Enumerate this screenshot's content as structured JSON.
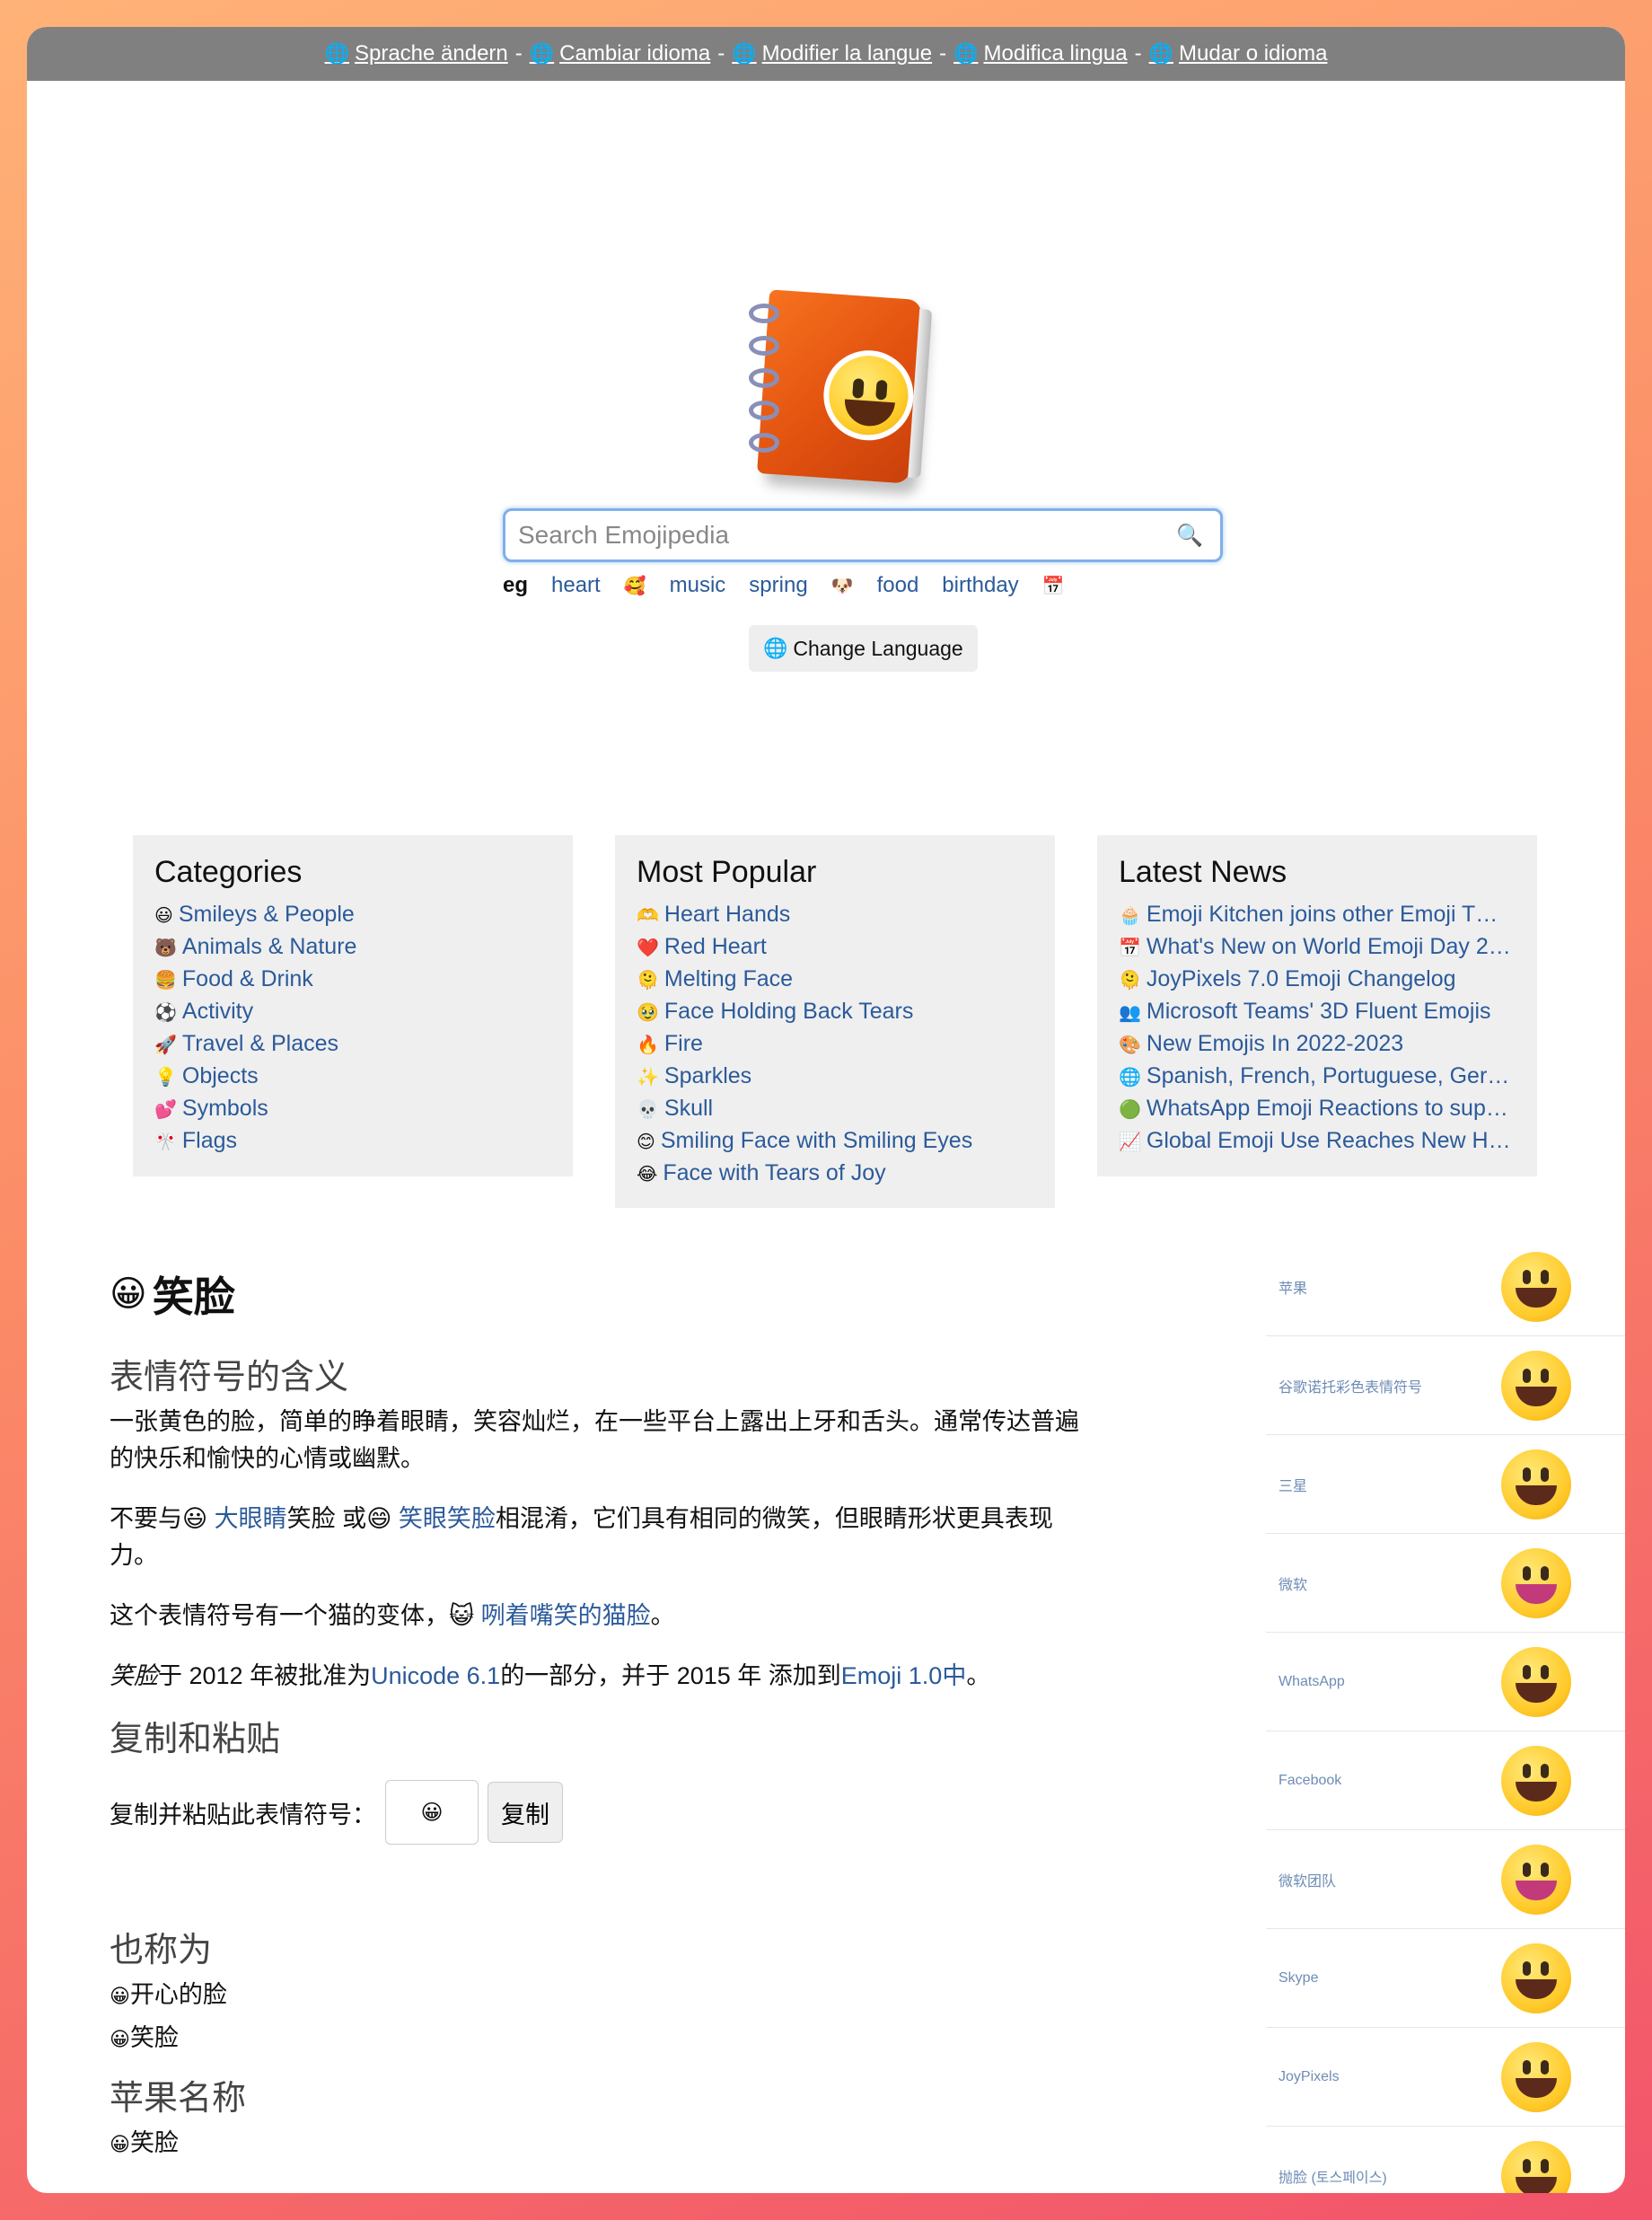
{
  "language_bar": {
    "items": [
      "Sprache ändern",
      "Cambiar idioma",
      "Modifier la langue",
      "Modifica lingua",
      "Mudar o idioma"
    ],
    "separator": "-"
  },
  "search": {
    "placeholder": "Search Emojipedia",
    "button_icon": "🔍",
    "suggestions_label": "eg",
    "suggestions": [
      {
        "label": "heart",
        "emoji": "🥰"
      },
      {
        "label": "music",
        "emoji": ""
      },
      {
        "label": "spring",
        "emoji": "🐶"
      },
      {
        "label": "food",
        "emoji": ""
      },
      {
        "label": "birthday",
        "emoji": "📅"
      }
    ]
  },
  "change_language": "Change Language",
  "categories": {
    "title": "Categories",
    "items": [
      {
        "icon": "😃",
        "label": "Smileys & People"
      },
      {
        "icon": "🐻",
        "label": "Animals & Nature"
      },
      {
        "icon": "🍔",
        "label": "Food & Drink"
      },
      {
        "icon": "⚽",
        "label": "Activity"
      },
      {
        "icon": "🚀",
        "label": "Travel & Places"
      },
      {
        "icon": "💡",
        "label": "Objects"
      },
      {
        "icon": "💕",
        "label": "Symbols"
      },
      {
        "icon": "🎌",
        "label": "Flags"
      }
    ]
  },
  "most_popular": {
    "title": "Most Popular",
    "items": [
      {
        "icon": "🫶",
        "label": "Heart Hands"
      },
      {
        "icon": "❤️",
        "label": "Red Heart"
      },
      {
        "icon": "🫠",
        "label": "Melting Face"
      },
      {
        "icon": "🥹",
        "label": "Face Holding Back Tears"
      },
      {
        "icon": "🔥",
        "label": "Fire"
      },
      {
        "icon": "✨",
        "label": "Sparkles"
      },
      {
        "icon": "💀",
        "label": "Skull"
      },
      {
        "icon": "😊",
        "label": "Smiling Face with Smiling Eyes"
      },
      {
        "icon": "😂",
        "label": "Face with Tears of Joy"
      }
    ]
  },
  "latest_news": {
    "title": "Latest News",
    "items": [
      {
        "icon": "🧁",
        "label": "Emoji Kitchen joins other Emoji T…"
      },
      {
        "icon": "📅",
        "label": "What's New on World Emoji Day 2…"
      },
      {
        "icon": "🫠",
        "label": "JoyPixels 7.0 Emoji Changelog"
      },
      {
        "icon": "👥",
        "label": "Microsoft Teams' 3D Fluent Emojis"
      },
      {
        "icon": "🎨",
        "label": "New Emojis In 2022-2023"
      },
      {
        "icon": "🌐",
        "label": "Spanish, French, Portuguese, Ger…"
      },
      {
        "icon": "🟢",
        "label": "WhatsApp Emoji Reactions to sup…"
      },
      {
        "icon": "📈",
        "label": "Global Emoji Use Reaches New H…"
      }
    ]
  },
  "emoji": {
    "glyph": "😀",
    "name": "笑脸",
    "meaning_heading": "表情符号的含义",
    "meaning_text": "一张黄色的脸，简单的睁着眼睛，笑容灿烂，在一些平台上露出上牙和舌头。通常传达普遍的快乐和愉快的心情或幽默。",
    "confusion": {
      "prefix": "不要与",
      "e1": "😃",
      "link1": "大眼睛",
      "mid1": "笑脸 或",
      "e2": "😄",
      "link2": "笑眼笑脸",
      "suffix": "相混淆，它们具有相同的微笑，但眼睛形状更具表现力。"
    },
    "variant": {
      "prefix": "这个表情符号有一个猫的变体，",
      "e": "😺",
      "link": "咧着嘴笑的猫脸",
      "suffix": "。"
    },
    "approval": {
      "name_italic": "笑脸",
      "p1": "于 2012 年被批准为",
      "link1": "Unicode 6.1",
      "p2": "的一部分，并于 2015 年 添加到",
      "link2": "Emoji 1.0中",
      "p3": "。"
    },
    "copy_heading": "复制和粘贴",
    "copy_label": "复制并粘贴此表情符号：",
    "copy_value": "😀",
    "copy_button": "复制",
    "also_heading": "也称为",
    "also": [
      "开心的脸",
      "笑脸"
    ],
    "apple_heading": "苹果名称",
    "apple": [
      "笑脸"
    ]
  },
  "vendors": [
    {
      "name": "苹果",
      "style": "yellow"
    },
    {
      "name": "谷歌诺托彩色表情符号",
      "style": "yellow"
    },
    {
      "name": "三星",
      "style": "yellow"
    },
    {
      "name": "微软",
      "style": "pink"
    },
    {
      "name": "WhatsApp",
      "style": "yellow"
    },
    {
      "name": "Facebook",
      "style": "yellow"
    },
    {
      "name": "微软团队",
      "style": "pink"
    },
    {
      "name": "Skype",
      "style": "yellow"
    },
    {
      "name": "JoyPixels",
      "style": "yellow"
    },
    {
      "name": "抛脸 (토스페이스)",
      "style": "yellow"
    }
  ]
}
